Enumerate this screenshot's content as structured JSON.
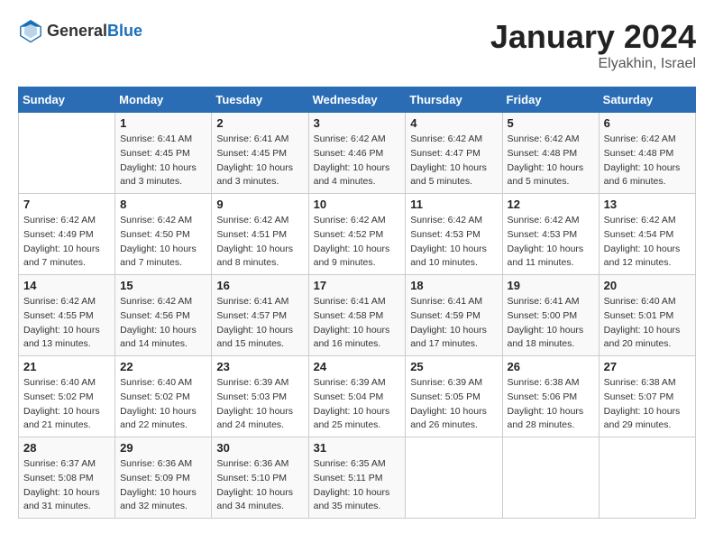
{
  "header": {
    "logo_general": "General",
    "logo_blue": "Blue",
    "title": "January 2024",
    "location": "Elyakhin, Israel"
  },
  "weekdays": [
    "Sunday",
    "Monday",
    "Tuesday",
    "Wednesday",
    "Thursday",
    "Friday",
    "Saturday"
  ],
  "weeks": [
    [
      {
        "day": "",
        "sunrise": "",
        "sunset": "",
        "daylight": ""
      },
      {
        "day": "1",
        "sunrise": "Sunrise: 6:41 AM",
        "sunset": "Sunset: 4:45 PM",
        "daylight": "Daylight: 10 hours and 3 minutes."
      },
      {
        "day": "2",
        "sunrise": "Sunrise: 6:41 AM",
        "sunset": "Sunset: 4:45 PM",
        "daylight": "Daylight: 10 hours and 3 minutes."
      },
      {
        "day": "3",
        "sunrise": "Sunrise: 6:42 AM",
        "sunset": "Sunset: 4:46 PM",
        "daylight": "Daylight: 10 hours and 4 minutes."
      },
      {
        "day": "4",
        "sunrise": "Sunrise: 6:42 AM",
        "sunset": "Sunset: 4:47 PM",
        "daylight": "Daylight: 10 hours and 5 minutes."
      },
      {
        "day": "5",
        "sunrise": "Sunrise: 6:42 AM",
        "sunset": "Sunset: 4:48 PM",
        "daylight": "Daylight: 10 hours and 5 minutes."
      },
      {
        "day": "6",
        "sunrise": "Sunrise: 6:42 AM",
        "sunset": "Sunset: 4:48 PM",
        "daylight": "Daylight: 10 hours and 6 minutes."
      }
    ],
    [
      {
        "day": "7",
        "sunrise": "Sunrise: 6:42 AM",
        "sunset": "Sunset: 4:49 PM",
        "daylight": "Daylight: 10 hours and 7 minutes."
      },
      {
        "day": "8",
        "sunrise": "Sunrise: 6:42 AM",
        "sunset": "Sunset: 4:50 PM",
        "daylight": "Daylight: 10 hours and 7 minutes."
      },
      {
        "day": "9",
        "sunrise": "Sunrise: 6:42 AM",
        "sunset": "Sunset: 4:51 PM",
        "daylight": "Daylight: 10 hours and 8 minutes."
      },
      {
        "day": "10",
        "sunrise": "Sunrise: 6:42 AM",
        "sunset": "Sunset: 4:52 PM",
        "daylight": "Daylight: 10 hours and 9 minutes."
      },
      {
        "day": "11",
        "sunrise": "Sunrise: 6:42 AM",
        "sunset": "Sunset: 4:53 PM",
        "daylight": "Daylight: 10 hours and 10 minutes."
      },
      {
        "day": "12",
        "sunrise": "Sunrise: 6:42 AM",
        "sunset": "Sunset: 4:53 PM",
        "daylight": "Daylight: 10 hours and 11 minutes."
      },
      {
        "day": "13",
        "sunrise": "Sunrise: 6:42 AM",
        "sunset": "Sunset: 4:54 PM",
        "daylight": "Daylight: 10 hours and 12 minutes."
      }
    ],
    [
      {
        "day": "14",
        "sunrise": "Sunrise: 6:42 AM",
        "sunset": "Sunset: 4:55 PM",
        "daylight": "Daylight: 10 hours and 13 minutes."
      },
      {
        "day": "15",
        "sunrise": "Sunrise: 6:42 AM",
        "sunset": "Sunset: 4:56 PM",
        "daylight": "Daylight: 10 hours and 14 minutes."
      },
      {
        "day": "16",
        "sunrise": "Sunrise: 6:41 AM",
        "sunset": "Sunset: 4:57 PM",
        "daylight": "Daylight: 10 hours and 15 minutes."
      },
      {
        "day": "17",
        "sunrise": "Sunrise: 6:41 AM",
        "sunset": "Sunset: 4:58 PM",
        "daylight": "Daylight: 10 hours and 16 minutes."
      },
      {
        "day": "18",
        "sunrise": "Sunrise: 6:41 AM",
        "sunset": "Sunset: 4:59 PM",
        "daylight": "Daylight: 10 hours and 17 minutes."
      },
      {
        "day": "19",
        "sunrise": "Sunrise: 6:41 AM",
        "sunset": "Sunset: 5:00 PM",
        "daylight": "Daylight: 10 hours and 18 minutes."
      },
      {
        "day": "20",
        "sunrise": "Sunrise: 6:40 AM",
        "sunset": "Sunset: 5:01 PM",
        "daylight": "Daylight: 10 hours and 20 minutes."
      }
    ],
    [
      {
        "day": "21",
        "sunrise": "Sunrise: 6:40 AM",
        "sunset": "Sunset: 5:02 PM",
        "daylight": "Daylight: 10 hours and 21 minutes."
      },
      {
        "day": "22",
        "sunrise": "Sunrise: 6:40 AM",
        "sunset": "Sunset: 5:02 PM",
        "daylight": "Daylight: 10 hours and 22 minutes."
      },
      {
        "day": "23",
        "sunrise": "Sunrise: 6:39 AM",
        "sunset": "Sunset: 5:03 PM",
        "daylight": "Daylight: 10 hours and 24 minutes."
      },
      {
        "day": "24",
        "sunrise": "Sunrise: 6:39 AM",
        "sunset": "Sunset: 5:04 PM",
        "daylight": "Daylight: 10 hours and 25 minutes."
      },
      {
        "day": "25",
        "sunrise": "Sunrise: 6:39 AM",
        "sunset": "Sunset: 5:05 PM",
        "daylight": "Daylight: 10 hours and 26 minutes."
      },
      {
        "day": "26",
        "sunrise": "Sunrise: 6:38 AM",
        "sunset": "Sunset: 5:06 PM",
        "daylight": "Daylight: 10 hours and 28 minutes."
      },
      {
        "day": "27",
        "sunrise": "Sunrise: 6:38 AM",
        "sunset": "Sunset: 5:07 PM",
        "daylight": "Daylight: 10 hours and 29 minutes."
      }
    ],
    [
      {
        "day": "28",
        "sunrise": "Sunrise: 6:37 AM",
        "sunset": "Sunset: 5:08 PM",
        "daylight": "Daylight: 10 hours and 31 minutes."
      },
      {
        "day": "29",
        "sunrise": "Sunrise: 6:36 AM",
        "sunset": "Sunset: 5:09 PM",
        "daylight": "Daylight: 10 hours and 32 minutes."
      },
      {
        "day": "30",
        "sunrise": "Sunrise: 6:36 AM",
        "sunset": "Sunset: 5:10 PM",
        "daylight": "Daylight: 10 hours and 34 minutes."
      },
      {
        "day": "31",
        "sunrise": "Sunrise: 6:35 AM",
        "sunset": "Sunset: 5:11 PM",
        "daylight": "Daylight: 10 hours and 35 minutes."
      },
      {
        "day": "",
        "sunrise": "",
        "sunset": "",
        "daylight": ""
      },
      {
        "day": "",
        "sunrise": "",
        "sunset": "",
        "daylight": ""
      },
      {
        "day": "",
        "sunrise": "",
        "sunset": "",
        "daylight": ""
      }
    ]
  ]
}
